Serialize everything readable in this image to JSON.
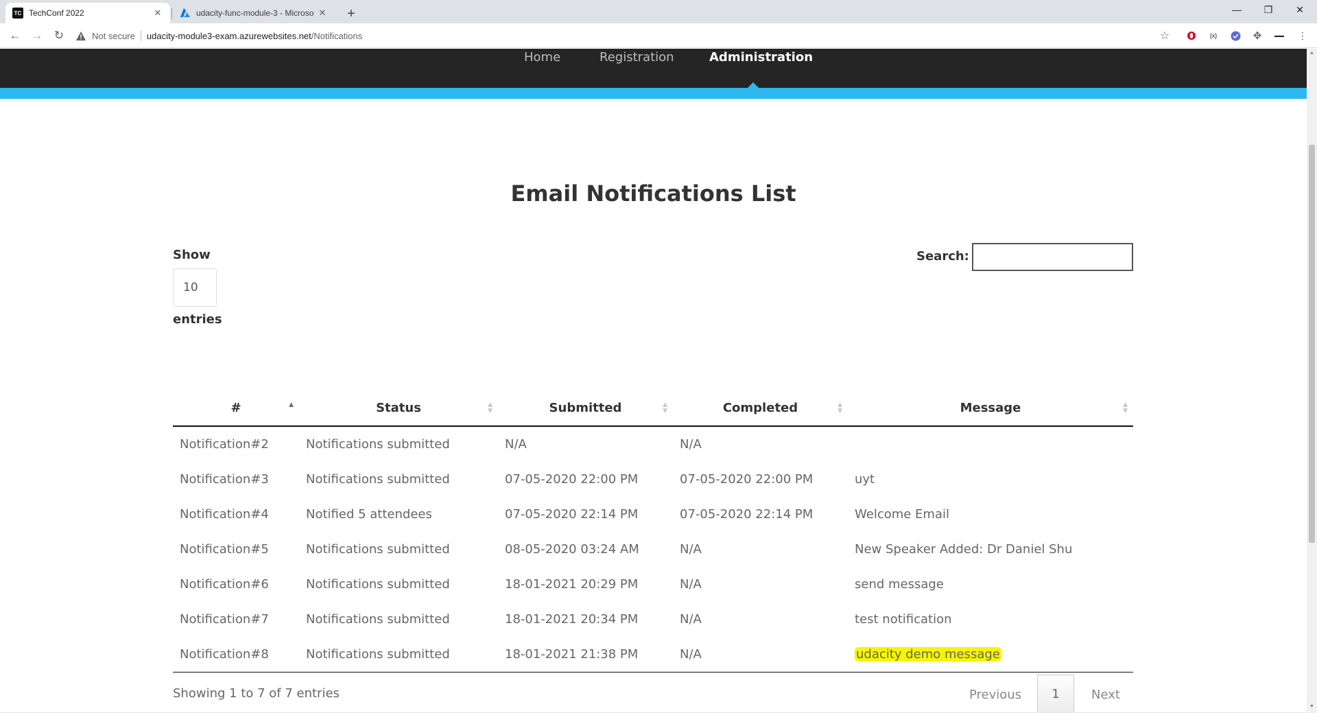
{
  "browser": {
    "tabs": [
      {
        "title": "TechConf 2022",
        "favicon": "TC"
      },
      {
        "title": "udacity-func-module-3 - Microso"
      }
    ],
    "security_label": "Not secure",
    "url_host": "udacity-module3-exam.azurewebsites.net",
    "url_path": "/Notifications"
  },
  "nav": {
    "items": [
      {
        "label": "Home"
      },
      {
        "label": "Registration"
      },
      {
        "label": "Administration"
      }
    ],
    "accent_color": "#2fb8f0"
  },
  "page": {
    "title": "Email Notifications List",
    "show_label": "Show",
    "page_length": "10",
    "entries_label": "entries",
    "search_label": "Search:",
    "search_value": ""
  },
  "table": {
    "columns": [
      "#",
      "Status",
      "Submitted",
      "Completed",
      "Message"
    ],
    "rows": [
      {
        "id": "Notification#2",
        "status": "Notifications submitted",
        "submitted": "N/A",
        "completed": "N/A",
        "message": ""
      },
      {
        "id": "Notification#3",
        "status": "Notifications submitted",
        "submitted": "07-05-2020 22:00 PM",
        "completed": "07-05-2020 22:00 PM",
        "message": "uyt"
      },
      {
        "id": "Notification#4",
        "status": "Notified 5 attendees",
        "submitted": "07-05-2020 22:14 PM",
        "completed": "07-05-2020 22:14 PM",
        "message": "Welcome Email"
      },
      {
        "id": "Notification#5",
        "status": "Notifications submitted",
        "submitted": "08-05-2020 03:24 AM",
        "completed": "N/A",
        "message": "New Speaker Added: Dr Daniel Shu"
      },
      {
        "id": "Notification#6",
        "status": "Notifications submitted",
        "submitted": "18-01-2021 20:29 PM",
        "completed": "N/A",
        "message": "send message"
      },
      {
        "id": "Notification#7",
        "status": "Notifications submitted",
        "submitted": "18-01-2021 20:34 PM",
        "completed": "N/A",
        "message": "test notification"
      },
      {
        "id": "Notification#8",
        "status": "Notifications submitted",
        "submitted": "18-01-2021 21:38 PM",
        "completed": "N/A",
        "message": "udacity demo message"
      }
    ],
    "highlight_color": "#f6f500"
  },
  "footer": {
    "info": "Showing 1 to 7 of 7 entries",
    "previous_label": "Previous",
    "current_page": "1",
    "next_label": "Next"
  }
}
